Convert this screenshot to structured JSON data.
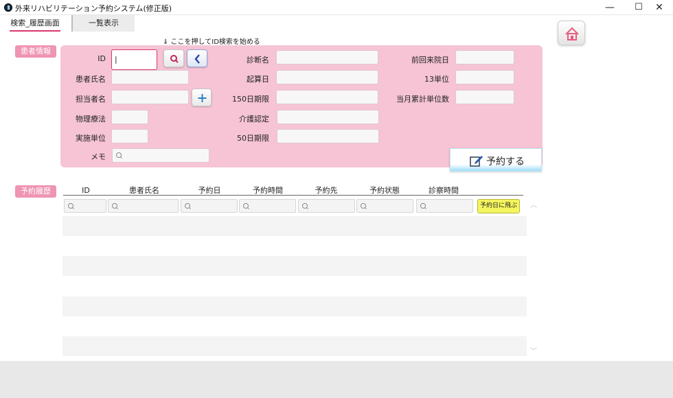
{
  "window": {
    "title": "外来リハビリテーション予約システム(修正版)",
    "minimize": "—",
    "maximize": "☐",
    "close": "✕"
  },
  "tabs": [
    "検索_履歴画面",
    "一覧表示"
  ],
  "hint": "⇓ ここを押してID検索を始める",
  "sections": {
    "patient_info": "患者情報",
    "history": "予約履歴"
  },
  "patient_form": {
    "col1": [
      "ID",
      "患者氏名",
      "担当者名",
      "物理療法",
      "実施単位",
      "メモ"
    ],
    "col2": [
      "診断名",
      "起算日",
      "150日期限",
      "介護認定",
      "50日期限"
    ],
    "col3": [
      "前回来院日",
      "13単位",
      "当月累計単位数"
    ],
    "id_value": "|"
  },
  "reserve_button": "予約する",
  "table": {
    "headers": [
      "ID",
      "患者氏名",
      "予約日",
      "予約時間",
      "予約先",
      "予約状態",
      "診察時間"
    ],
    "jump_button": "予約日に飛ぶ",
    "scroll_up": "︿",
    "scroll_down": "﹀"
  },
  "colors": {
    "panel_pink": "#f6c4d4",
    "badge_pink": "#ef94b3",
    "accent": "#d9356f",
    "jump_yellow": "#f5f55e"
  }
}
